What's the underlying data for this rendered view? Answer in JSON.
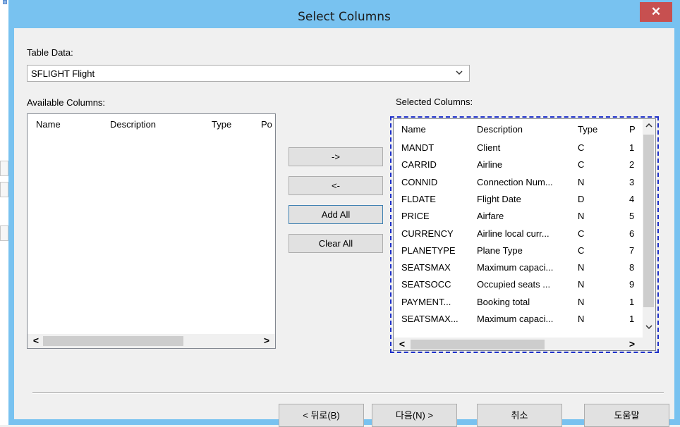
{
  "dialog": {
    "title": "Select Columns",
    "close_glyph": "✕"
  },
  "table_data": {
    "label": "Table Data:",
    "selected": "SFLIGHT Flight",
    "arrow_icon": "chevron-down-icon"
  },
  "available": {
    "label": "Available Columns:",
    "columns": [
      "Name",
      "Description",
      "Type",
      "Po"
    ],
    "rows": []
  },
  "selected": {
    "label": "Selected Columns:",
    "columns": [
      "Name",
      "Description",
      "Type",
      "P"
    ],
    "rows": [
      {
        "name": "MANDT",
        "description": "Client",
        "type": "C",
        "pos": "1"
      },
      {
        "name": "CARRID",
        "description": "Airline",
        "type": "C",
        "pos": "2"
      },
      {
        "name": "CONNID",
        "description": "Connection Num...",
        "type": "N",
        "pos": "3"
      },
      {
        "name": "FLDATE",
        "description": "Flight Date",
        "type": "D",
        "pos": "4"
      },
      {
        "name": "PRICE",
        "description": "Airfare",
        "type": "N",
        "pos": "5"
      },
      {
        "name": "CURRENCY",
        "description": "Airline local curr...",
        "type": "C",
        "pos": "6"
      },
      {
        "name": "PLANETYPE",
        "description": "Plane Type",
        "type": "C",
        "pos": "7"
      },
      {
        "name": "SEATSMAX",
        "description": "Maximum capaci...",
        "type": "N",
        "pos": "8"
      },
      {
        "name": "SEATSOCC",
        "description": "Occupied seats ...",
        "type": "N",
        "pos": "9"
      },
      {
        "name": "PAYMENT...",
        "description": "Booking total",
        "type": "N",
        "pos": "1"
      },
      {
        "name": "SEATSMAX...",
        "description": "Maximum capaci...",
        "type": "N",
        "pos": "1"
      }
    ]
  },
  "transfer_buttons": {
    "add": "->",
    "remove": "<-",
    "add_all": "Add All",
    "clear_all": "Clear All"
  },
  "scroll": {
    "left_glyph": "<",
    "right_glyph": ">",
    "up_glyph": "^",
    "down_glyph": "v"
  },
  "footer": {
    "back": "< 뒤로(B)",
    "next": "다음(N) >",
    "cancel": "취소",
    "help": "도움말"
  },
  "colors": {
    "title_bar": "#78c2f0",
    "close_button": "#c75050",
    "focus_rect": "#1d2fc9"
  }
}
